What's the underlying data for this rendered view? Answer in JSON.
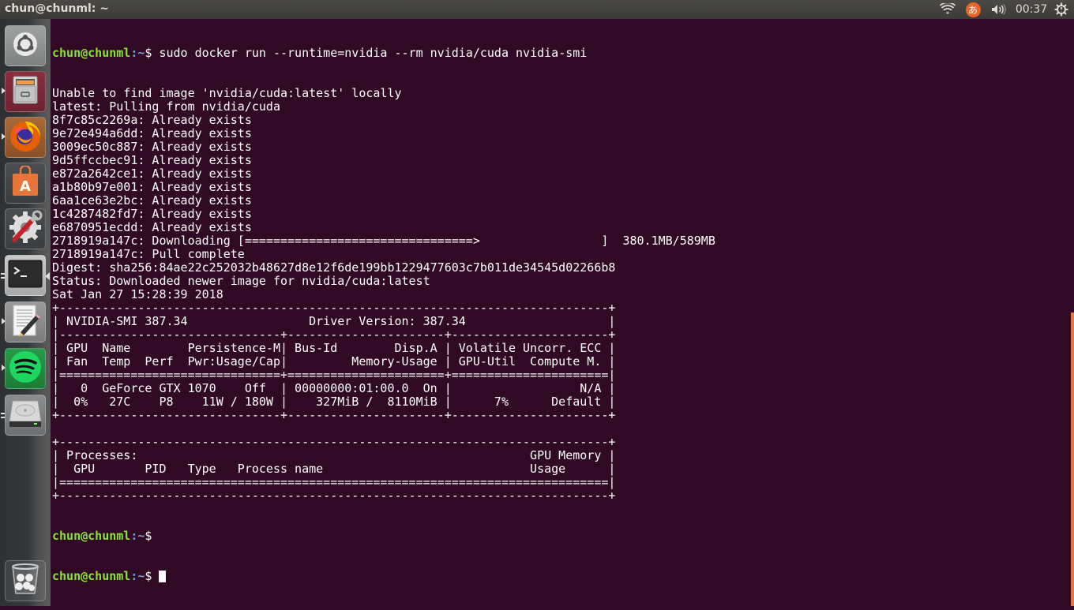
{
  "top_panel": {
    "window_title": "chun@chunml: ~",
    "indicators": {
      "wifi": "wifi-icon",
      "input_method": "あ",
      "volume": "volume-icon",
      "clock": "00:37",
      "settings": "power-gear-icon"
    }
  },
  "launcher": {
    "items": [
      {
        "name": "ubuntu-dash",
        "icon": "ubuntu-logo-icon"
      },
      {
        "name": "files",
        "icon": "file-cabinet-icon"
      },
      {
        "name": "firefox",
        "icon": "firefox-icon"
      },
      {
        "name": "ubuntu-software",
        "icon": "shopping-bag-icon",
        "glyph": "A"
      },
      {
        "name": "system-settings",
        "icon": "gear-wrench-icon"
      },
      {
        "name": "terminal",
        "icon": "terminal-icon",
        "glyph": ">_"
      },
      {
        "name": "text-editor",
        "icon": "text-editor-icon"
      },
      {
        "name": "spotify",
        "icon": "spotify-icon"
      },
      {
        "name": "disk",
        "icon": "hard-drive-icon"
      },
      {
        "name": "trash",
        "icon": "trash-icon"
      }
    ]
  },
  "terminal": {
    "prompt": {
      "user_host": "chun@chunml",
      "path": ":~",
      "symbol": "$"
    },
    "command": " sudo docker run --runtime=nvidia --rm nvidia/cuda nvidia-smi",
    "output_lines": [
      "Unable to find image 'nvidia/cuda:latest' locally",
      "latest: Pulling from nvidia/cuda",
      "8f7c85c2269a: Already exists",
      "9e72e494a6dd: Already exists",
      "3009ec50c887: Already exists",
      "9d5ffccbec91: Already exists",
      "e872a2642ce1: Already exists",
      "a1b80b97e001: Already exists",
      "6aa1ce63e2bc: Already exists",
      "1c4287482fd7: Already exists",
      "e6870951ecdd: Already exists",
      "2718919a147c: Downloading [================================>                 ]  380.1MB/589MB",
      "2718919a147c: Pull complete",
      "Digest: sha256:84ae22c252032b48627d8e12f6de199bb1229477603c7b011de34545d02266b8",
      "Status: Downloaded newer image for nvidia/cuda:latest",
      "Sat Jan 27 15:28:39 2018",
      "+-----------------------------------------------------------------------------+",
      "| NVIDIA-SMI 387.34                 Driver Version: 387.34                    |",
      "|-------------------------------+----------------------+----------------------+",
      "| GPU  Name        Persistence-M| Bus-Id        Disp.A | Volatile Uncorr. ECC |",
      "| Fan  Temp  Perf  Pwr:Usage/Cap|         Memory-Usage | GPU-Util  Compute M. |",
      "|===============================+======================+======================|",
      "|   0  GeForce GTX 1070    Off  | 00000000:01:00.0  On |                  N/A |",
      "|  0%   27C    P8    11W / 180W |    327MiB /  8110MiB |      7%      Default |",
      "+-------------------------------+----------------------+----------------------+",
      "",
      "+-----------------------------------------------------------------------------+",
      "| Processes:                                                       GPU Memory |",
      "|  GPU       PID   Type   Process name                             Usage      |",
      "|=============================================================================|",
      "+-----------------------------------------------------------------------------+"
    ],
    "download_progress": {
      "layer": "2718919a147c",
      "downloaded": "380.1MB",
      "total": "589MB"
    },
    "gpu_info": {
      "nvidia_smi_version": "387.34",
      "driver_version": "387.34",
      "gpu_index": "0",
      "name": "GeForce GTX 1070",
      "persistence_mode": "Off",
      "bus_id": "00000000:01:00.0",
      "display_active": "On",
      "ecc": "N/A",
      "fan": "0%",
      "temp": "27C",
      "perf": "P8",
      "power_usage": "11W",
      "power_cap": "180W",
      "memory_used": "327MiB",
      "memory_total": "8110MiB",
      "gpu_util": "7%",
      "compute_mode": "Default"
    }
  },
  "colors": {
    "terminal_bg": "#300a24",
    "prompt_user": "#8ae234",
    "prompt_path": "#729fcf",
    "text": "#ffffff",
    "scrollbar": "#e07a4a"
  }
}
